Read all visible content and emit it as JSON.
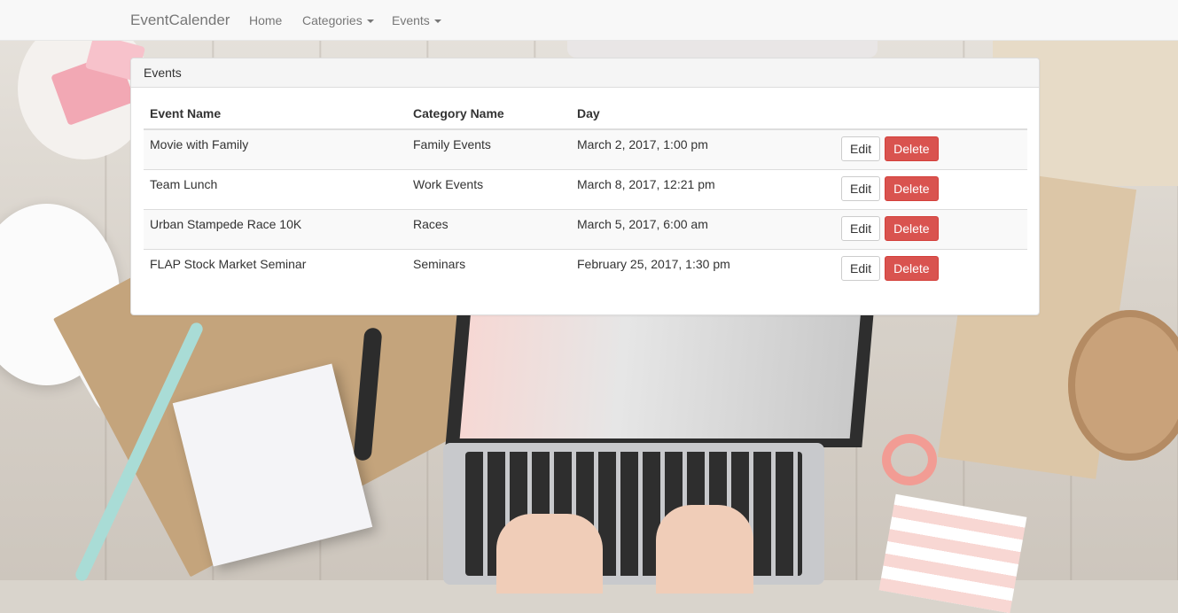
{
  "navbar": {
    "brand": "EventCalender",
    "links": [
      {
        "label": "Home"
      },
      {
        "label": "Categories"
      },
      {
        "label": "Events"
      }
    ]
  },
  "panel": {
    "title": "Events",
    "columns": [
      "Event Name",
      "Category Name",
      "Day"
    ],
    "rows": [
      {
        "event": "Movie with Family",
        "category": "Family Events",
        "day": "March 2, 2017, 1:00 pm"
      },
      {
        "event": "Team Lunch",
        "category": "Work Events",
        "day": "March 8, 2017, 12:21 pm"
      },
      {
        "event": "Urban Stampede Race 10K",
        "category": "Races",
        "day": "March 5, 2017, 6:00 am"
      },
      {
        "event": "FLAP Stock Market Seminar",
        "category": "Seminars",
        "day": "February 25, 2017, 1:30 pm"
      }
    ],
    "edit_label": "Edit",
    "delete_label": "Delete"
  },
  "colors": {
    "navbar_bg": "#f8f8f8",
    "delete_button": "#d9534f",
    "table_stripe": "#f9f9f9"
  }
}
